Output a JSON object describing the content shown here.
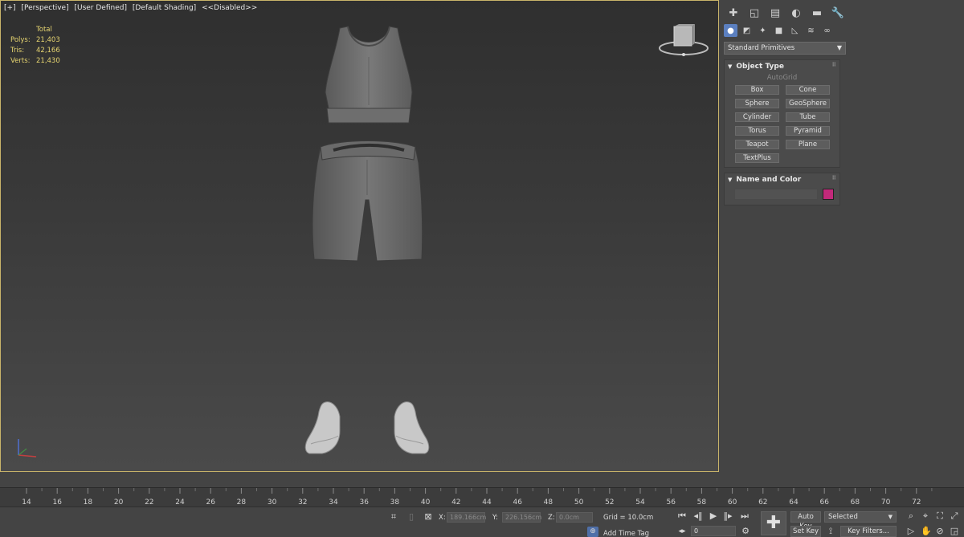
{
  "viewport": {
    "labels": [
      "[+]",
      "[Perspective]",
      "[User Defined]",
      "[Default Shading]",
      "<<Disabled>>"
    ],
    "stats": {
      "header": "Total",
      "rows": [
        {
          "label": "Polys:",
          "value": "21,403"
        },
        {
          "label": "Tris:",
          "value": "42,166"
        },
        {
          "label": "Verts:",
          "value": "21,430"
        }
      ]
    }
  },
  "command_panel": {
    "tab_icons": [
      "create-icon",
      "modify-icon",
      "hierarchy-icon",
      "motion-icon",
      "display-icon",
      "utilities-icon"
    ],
    "sub_icons": [
      "geometry-icon",
      "shapes-icon",
      "lights-icon",
      "cameras-icon",
      "helpers-icon",
      "spacewarps-icon",
      "systems-icon"
    ],
    "category": "Standard Primitives",
    "object_type": {
      "title": "Object Type",
      "autogrid": "AutoGrid",
      "buttons": [
        "Box",
        "Cone",
        "Sphere",
        "GeoSphere",
        "Cylinder",
        "Tube",
        "Torus",
        "Pyramid",
        "Teapot",
        "Plane",
        "TextPlus"
      ]
    },
    "name_color": {
      "title": "Name and Color",
      "name_value": "",
      "swatch_color": "#c2297a"
    }
  },
  "timeline": {
    "tick_labels": [
      "14",
      "16",
      "18",
      "20",
      "22",
      "24",
      "26",
      "28",
      "30",
      "32",
      "34",
      "36",
      "38",
      "40",
      "42",
      "44",
      "46",
      "48",
      "50",
      "52",
      "54",
      "56",
      "58",
      "60",
      "62",
      "64",
      "66",
      "68",
      "70",
      "72"
    ]
  },
  "status": {
    "x_label": "X:",
    "x_value": "189.166cm",
    "y_label": "Y:",
    "y_value": "226.156cm",
    "z_label": "Z:",
    "z_value": "0.0cm",
    "grid": "Grid = 10.0cm",
    "add_time_tag": "Add Time Tag",
    "frame_value": "0",
    "auto_key": "Auto Key",
    "set_key": "Set Key",
    "selected": "Selected",
    "key_filters": "Key Filters..."
  },
  "colors": {
    "viewport_border": "#c9b46a",
    "stats_text": "#e6d470",
    "active_tab": "#5b7fbf"
  }
}
